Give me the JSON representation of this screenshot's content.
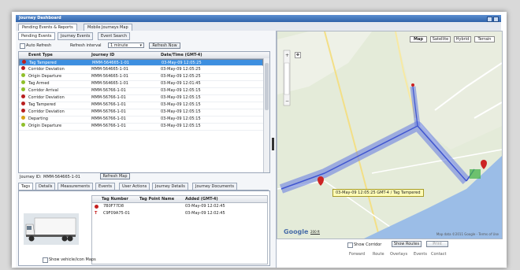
{
  "window": {
    "title": "Journey Dashboard"
  },
  "main_tabs": [
    "Pending Events & Reports",
    "Mobile Journeys Map"
  ],
  "sub_tabs": [
    "Pending Events",
    "Journey Events",
    "Event Search"
  ],
  "toolbar": {
    "auto_refresh_label": "Auto Refresh",
    "refresh_interval_label": "Refresh interval",
    "refresh_interval_value": "1 minute",
    "refresh_button": "Refresh Now"
  },
  "events_grid": {
    "columns": [
      "Event Type",
      "Journey ID",
      "Date/Time (GMT-4)"
    ],
    "rows": [
      {
        "type": "Tag Tampered",
        "journey": "MMM-564665-1-01",
        "datetime": "03-May-09 12:05:25",
        "color": "#b91f1f",
        "selected": true
      },
      {
        "type": "Corridor Deviation",
        "journey": "MMM-564665-1-01",
        "datetime": "03-May-09 12:05:25",
        "color": "#b91f1f",
        "selected": false
      },
      {
        "type": "Origin Departure",
        "journey": "MMM-564665-1-01",
        "datetime": "03-May-09 12:05:25",
        "color": "#8fbf2a",
        "selected": false
      },
      {
        "type": "Tag Armed",
        "journey": "MMM-564665-1-01",
        "datetime": "03-May-09 12:01:45",
        "color": "#8fbf2a",
        "selected": false
      },
      {
        "type": "Corridor Arrival",
        "journey": "MMM-56766-1-01",
        "datetime": "03-May-09 12:05:15",
        "color": "#8fbf2a",
        "selected": false
      },
      {
        "type": "Corridor Deviation",
        "journey": "MMM-56766-1-01",
        "datetime": "03-May-09 12:05:15",
        "color": "#b91f1f",
        "selected": false
      },
      {
        "type": "Tag Tampered",
        "journey": "MMM-56766-1-01",
        "datetime": "03-May-09 12:05:15",
        "color": "#b91f1f",
        "selected": false
      },
      {
        "type": "Corridor Deviation",
        "journey": "MMM-56766-1-01",
        "datetime": "03-May-09 12:05:15",
        "color": "#b91f1f",
        "selected": false
      },
      {
        "type": "Departing",
        "journey": "MMM-56766-1-01",
        "datetime": "03-May-09 12:05:15",
        "color": "#d8a316",
        "selected": false
      },
      {
        "type": "Origin Departure",
        "journey": "MMM-56766-1-01",
        "datetime": "03-May-09 12:05:15",
        "color": "#8fbf2a",
        "selected": false
      }
    ]
  },
  "status_bar": {
    "journey_label": "Journey ID:",
    "journey_value": "MMM-564665-1-01",
    "refresh_map": "Refresh Map"
  },
  "detail_tabs": [
    "Tags",
    "Details",
    "Measurements",
    "Events",
    "User Actions",
    "Journey Details",
    "Journey Documents"
  ],
  "tags_grid": {
    "columns": [
      "Tag Number",
      "Tag Point Name",
      "Added (GMT-4)"
    ],
    "rows": [
      {
        "tag": "7B0F77D8",
        "point": "",
        "added": "03-May-09 12:02:45",
        "icon": "dot"
      },
      {
        "tag": "C9F09A75-01",
        "point": "",
        "added": "03-May-09 12:02:45",
        "icon": "tag"
      }
    ]
  },
  "show_vehicle_label": "Show vehicle/icon Maps",
  "map": {
    "buttons": [
      "Map",
      "Satellite",
      "Hybrid",
      "Terrain"
    ],
    "event_label": "03-May-09 12:05:25 GMT-4 / Tag Tampered",
    "logo": "Google",
    "attribution": "Map data ©2011 Google - Terms of Use",
    "scale": "200 ft"
  },
  "map_controls": {
    "show_corridor": "Show Corridor",
    "show_routes_button": "Show Routes",
    "print_button": "Print",
    "links": [
      "Forward",
      "Route",
      "Overlays",
      "Events",
      "Contact"
    ]
  }
}
